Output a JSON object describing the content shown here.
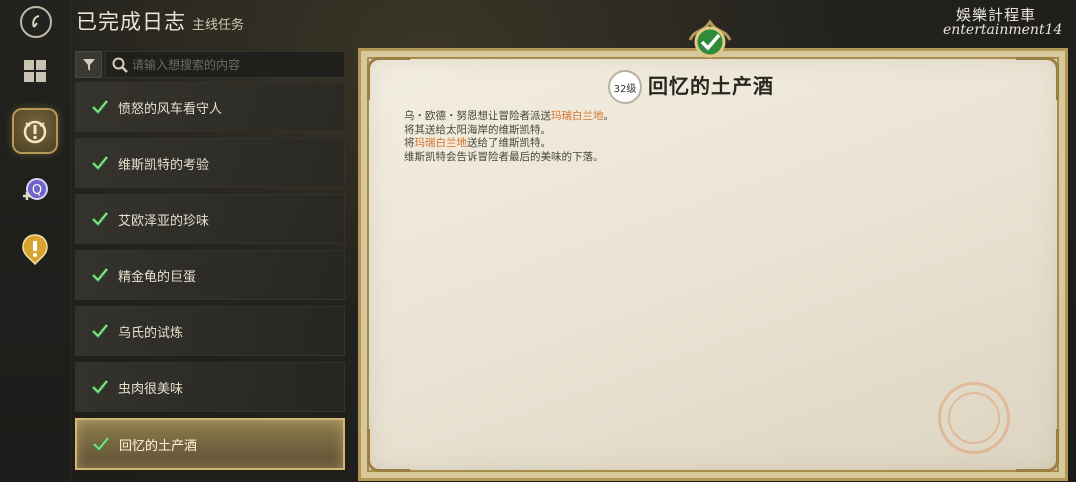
{
  "header": {
    "title": "已完成日志",
    "subtitle": "主线任务"
  },
  "search": {
    "placeholder": "请输入想搜索的内容"
  },
  "rail": {
    "icons": [
      "app-logo-icon",
      "grid-icon",
      "main-quest-icon",
      "add-quest-icon",
      "alert-quest-icon"
    ]
  },
  "quests": [
    {
      "label": "愤怒的风车看守人",
      "completed": true
    },
    {
      "label": "维斯凯特的考验",
      "completed": true
    },
    {
      "label": "艾欧泽亚的珍味",
      "completed": true
    },
    {
      "label": "精金龟的巨蛋",
      "completed": true
    },
    {
      "label": "乌氏的试炼",
      "completed": true
    },
    {
      "label": "虫肉很美味",
      "completed": true
    },
    {
      "label": "回忆的土产酒",
      "completed": true,
      "selected": true
    }
  ],
  "detail": {
    "level": "32级",
    "title": "回忆的土产酒",
    "lines": [
      {
        "pre": "乌・欧德・努恩想让冒险者派送",
        "hl": "玛瑞白兰地",
        "post": "。"
      },
      {
        "pre": "将其送给太阳海岸的维斯凯特。",
        "hl": "",
        "post": ""
      },
      {
        "pre": "将",
        "hl": "玛瑞白兰地",
        "post": "送给了维斯凯特。"
      },
      {
        "pre": "维斯凯特会告诉冒险者最后的美味的下落。",
        "hl": "",
        "post": ""
      }
    ]
  },
  "watermark": {
    "line1": "娛樂計程車",
    "line2": "entertainment14"
  },
  "colors": {
    "accent_gold": "#d2b76f",
    "highlight_orange": "#d5722b",
    "check_green": "#35a84a"
  }
}
